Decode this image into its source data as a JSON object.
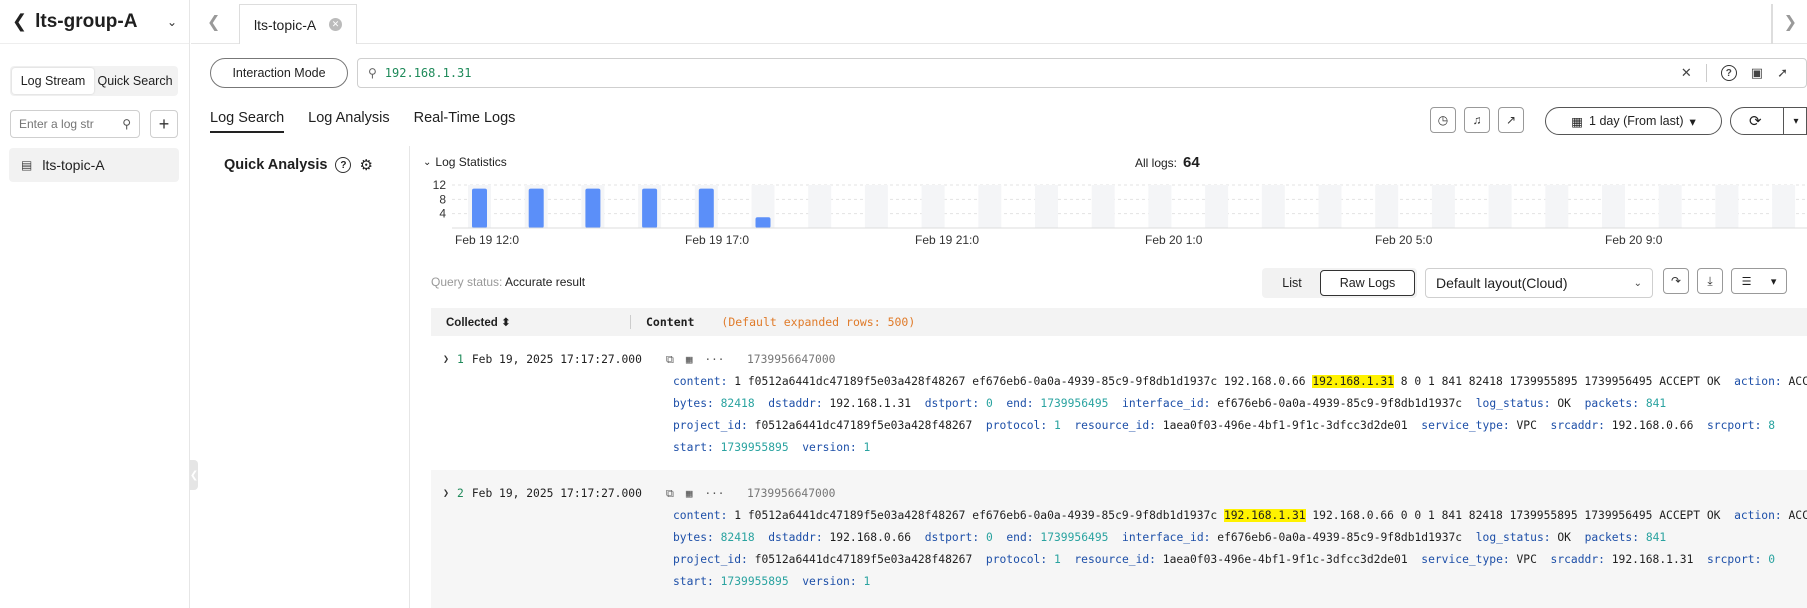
{
  "sidebar": {
    "title": "lts-group-A",
    "tabs": [
      "Log Stream",
      "Quick Search"
    ],
    "search_placeholder": "Enter a log str",
    "items": [
      {
        "label": "lts-topic-A"
      }
    ]
  },
  "tabbar": {
    "active_tab": "lts-topic-A"
  },
  "query": {
    "mode_button": "Interaction Mode",
    "value": "192.168.1.31"
  },
  "main_tabs": [
    "Log Search",
    "Log Analysis",
    "Real-Time Logs"
  ],
  "time_range": "1 day (From last)",
  "quick_analysis": {
    "title": "Quick Analysis"
  },
  "stats": {
    "header": "Log Statistics",
    "all_logs_label": "All logs:",
    "all_logs_value": "64"
  },
  "chart_data": {
    "type": "bar",
    "y_ticks": [
      12,
      8,
      4
    ],
    "x_tick_labels": [
      "Feb 19 12:0",
      "Feb 19 17:0",
      "Feb 19 21:0",
      "Feb 20 1:0",
      "Feb 20 5:0",
      "Feb 20 9:0"
    ],
    "values": [
      11,
      11,
      11,
      11,
      11,
      3,
      0,
      0,
      0,
      0,
      0,
      0,
      0,
      0,
      0,
      0,
      0,
      0,
      0,
      0,
      0,
      0,
      0,
      0
    ],
    "ylim": [
      0,
      12
    ],
    "colors": {
      "bar": "#5b8ff9",
      "empty": "#f4f5f7"
    }
  },
  "results": {
    "query_status_label": "Query status:",
    "query_status_value": "Accurate result",
    "view_list": "List",
    "view_raw": "Raw Logs",
    "layout": "Default layout(Cloud)",
    "col_collected": "Collected",
    "col_content": "Content",
    "col_note": "(Default expanded rows: 500)"
  },
  "logs": [
    {
      "num": "1",
      "time": "Feb 19, 2025 17:17:27.000",
      "ts": "1739956647000",
      "content_pre": "1 f0512a6441dc47189f5e03a428f48267 ef676eb6-0a0a-4939-85c9-9f8db1d1937c 192.168.0.66 ",
      "content_hl": "192.168.1.31",
      "content_post": " 8 0 1 841 82418 1739955895 1739956495 ACCEPT OK",
      "action": "ACCEPT",
      "bytes": "82418",
      "dstaddr": "192.168.1.31",
      "dstport": "0",
      "end": "1739956495",
      "interface_id": "ef676eb6-0a0a-4939-85c9-9f8db1d1937c",
      "log_status": "OK",
      "packets": "841",
      "project_id": "f0512a6441dc47189f5e03a428f48267",
      "protocol": "1",
      "resource_id": "1aea0f03-496e-4bf1-9f1c-3dfcc3d2de01",
      "service_type": "VPC",
      "srcaddr": "192.168.0.66",
      "srcport": "8",
      "start": "1739955895",
      "version": "1"
    },
    {
      "num": "2",
      "time": "Feb 19, 2025 17:17:27.000",
      "ts": "1739956647000",
      "content_pre": "1 f0512a6441dc47189f5e03a428f48267 ef676eb6-0a0a-4939-85c9-9f8db1d1937c ",
      "content_hl": "192.168.1.31",
      "content_post": " 192.168.0.66 0 0 1 841 82418 1739955895 1739956495 ACCEPT OK",
      "action": "ACCEPT",
      "bytes": "82418",
      "dstaddr": "192.168.0.66",
      "dstport": "0",
      "end": "1739956495",
      "interface_id": "ef676eb6-0a0a-4939-85c9-9f8db1d1937c",
      "log_status": "OK",
      "packets": "841",
      "project_id": "f0512a6441dc47189f5e03a428f48267",
      "protocol": "1",
      "resource_id": "1aea0f03-496e-4bf1-9f1c-3dfcc3d2de01",
      "service_type": "VPC",
      "srcaddr": "192.168.1.31",
      "srcport": "0",
      "start": "1739955895",
      "version": "1"
    }
  ]
}
